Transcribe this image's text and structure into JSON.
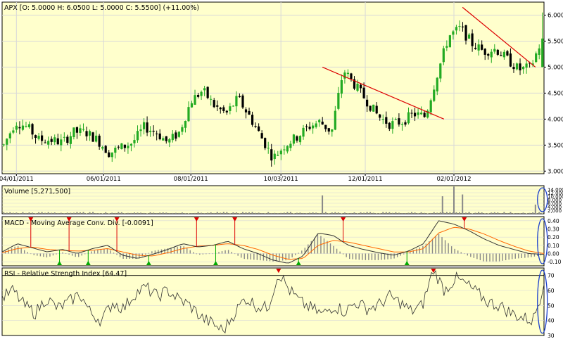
{
  "colors": {
    "background": "#ffffcc",
    "grid": "#d8d8d8",
    "frame": "#000000",
    "up": "#22aa22",
    "down": "#000000",
    "trendline": "#dd0000",
    "signal_line": "#ff6600",
    "macd_line": "#333333",
    "histogram": "#888888",
    "marker_sell": "#dd0000",
    "marker_buy": "#00aa00",
    "highlight_ellipse": "#1a3fcc"
  },
  "panels": {
    "price": {
      "title": "APX [O: 5.0000  H: 6.0500  L: 5.0000  C: 5.5500] (+11.00%)",
      "y_ticks": [
        "6.000",
        "5.500",
        "5.000",
        "4.500",
        "4.000",
        "3.500",
        "3.000"
      ],
      "x_ticks": [
        "04/01/2011",
        "06/01/2011",
        "08/01/2011",
        "10/03/2011",
        "12/01/2011",
        "02/01/2012"
      ]
    },
    "volume": {
      "title": "Volume [5,271,500]",
      "y_ticks": [
        "14,000",
        "12,000",
        "10,000",
        "8,000",
        "6,000",
        "4,000",
        "2,000"
      ]
    },
    "macd": {
      "title": "MACD - Moving Average Conv. Div. [-0.0091]",
      "y_ticks": [
        "0.40",
        "0.30",
        "0.20",
        "0.10",
        "0.00",
        "-0.10"
      ]
    },
    "rsi": {
      "title": "RSI - Relative Strength Index [64.47]",
      "y_ticks": [
        "70",
        "60",
        "50",
        "40",
        "30"
      ]
    }
  },
  "chart_data": [
    {
      "type": "candlestick",
      "title": "APX [O: 5.0000  H: 6.0500  L: 5.0000  C: 5.5500] (+11.00%)",
      "ylim": [
        2.95,
        6.25
      ],
      "x_dates": [
        "04/01/2011",
        "06/01/2011",
        "08/01/2011",
        "10/03/2011",
        "12/01/2011",
        "02/01/2012"
      ],
      "last_bar": {
        "open": 5.0,
        "high": 6.05,
        "low": 5.0,
        "close": 5.55,
        "change_pct": 11.0
      },
      "close_path": [
        3.5,
        3.95,
        3.85,
        3.6,
        3.6,
        3.55,
        3.75,
        3.75,
        3.6,
        3.35,
        3.45,
        3.55,
        3.85,
        3.75,
        3.55,
        3.75,
        4.35,
        4.55,
        4.25,
        4.1,
        4.4,
        4.05,
        3.65,
        3.25,
        3.5,
        3.65,
        3.85,
        3.95,
        3.75,
        4.95,
        4.65,
        4.35,
        4.05,
        3.9,
        3.95,
        4.1,
        4.05,
        4.85,
        5.6,
        5.75,
        5.45,
        5.3,
        5.35,
        5.15,
        4.95,
        5.0,
        5.55
      ],
      "trendlines": [
        {
          "from": {
            "date": "11/01/2011",
            "price": 5.0
          },
          "to": {
            "date": "01/25/2012",
            "price": 4.0
          }
        },
        {
          "from": {
            "date": "02/07/2012",
            "price": 6.15
          },
          "to": {
            "date": "03/29/2012",
            "price": 5.0
          }
        }
      ]
    },
    {
      "type": "bar",
      "title": "Volume [5,271,500]",
      "ylim": [
        0,
        16000
      ],
      "spikes": [
        {
          "date": "11/01/2011",
          "value": 10500
        },
        {
          "date": "01/24/2012",
          "value": 10000
        },
        {
          "date": "02/01/2012",
          "value": 15500
        },
        {
          "date": "02/07/2012",
          "value": 11000
        },
        {
          "date": "03/29/2012",
          "value": 5271
        }
      ]
    },
    {
      "type": "line",
      "title": "MACD - Moving Average Conv. Div. [-0.0091]",
      "ylim": [
        -0.15,
        0.45
      ],
      "series": [
        {
          "values": [
            0.02,
            0.12,
            0.07,
            0.02,
            0.05,
            0.0,
            0.06,
            0.1,
            -0.02,
            -0.06,
            -0.01,
            0.05,
            0.12,
            0.08,
            0.1,
            0.15,
            0.06,
            0.0,
            -0.08,
            -0.12,
            -0.03,
            0.25,
            0.22,
            0.1,
            0.05,
            0.01,
            -0.02,
            0.03,
            0.12,
            0.4,
            0.36,
            0.28,
            0.18,
            0.1,
            0.05,
            0.0,
            -0.01
          ]
        },
        {
          "values": [
            0.01,
            0.06,
            0.08,
            0.05,
            0.04,
            0.03,
            0.04,
            0.06,
            0.02,
            -0.02,
            -0.03,
            0.01,
            0.06,
            0.09,
            0.1,
            0.12,
            0.1,
            0.05,
            -0.02,
            -0.07,
            -0.06,
            0.1,
            0.16,
            0.14,
            0.1,
            0.06,
            0.02,
            0.02,
            0.06,
            0.25,
            0.32,
            0.3,
            0.24,
            0.16,
            0.09,
            0.03,
            0.0
          ]
        }
      ]
    },
    {
      "type": "line",
      "title": "RSI - Relative Strength Index [64.47]",
      "ylim": [
        30,
        75
      ],
      "series": [
        {
          "values": [
            55,
            60,
            50,
            45,
            55,
            48,
            52,
            58,
            45,
            40,
            52,
            48,
            58,
            62,
            56,
            60,
            54,
            50,
            42,
            38,
            33,
            45,
            55,
            50,
            48,
            72,
            60,
            52,
            48,
            44,
            50,
            46,
            52,
            48,
            50,
            56,
            52,
            46,
            50,
            74,
            60,
            68,
            64,
            58,
            52,
            50,
            45,
            42,
            40,
            64
          ]
        }
      ]
    }
  ]
}
